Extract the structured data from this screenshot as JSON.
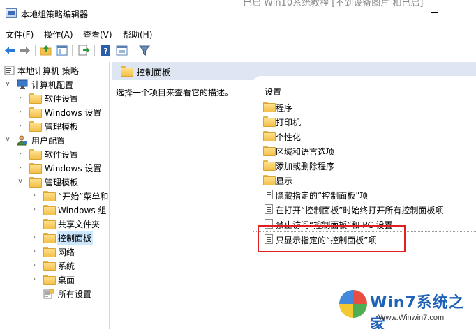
{
  "window": {
    "title": "本地组策略编辑器",
    "bg_title_fragment": "已启 Win10系统教程 [不到设备图片 相已启]"
  },
  "menu": [
    {
      "label": "文件(F)"
    },
    {
      "label": "操作(A)"
    },
    {
      "label": "查看(V)"
    },
    {
      "label": "帮助(H)"
    }
  ],
  "toolbar": [
    "back-icon",
    "forward-icon",
    "up-folder-icon",
    "show-hide-tree-icon",
    "export-list-icon",
    "help-icon",
    "properties-icon",
    "filter-icon"
  ],
  "tree": [
    {
      "label": "本地计算机 策略",
      "level": 0,
      "expander": "",
      "icon": "computer-policy-icon"
    },
    {
      "label": "计算机配置",
      "level": 1,
      "expander": "expanded",
      "icon": "computer-config-icon"
    },
    {
      "label": "软件设置",
      "level": 2,
      "expander": "collapsed",
      "icon": "folder-icon"
    },
    {
      "label": "Windows 设置",
      "level": 2,
      "expander": "collapsed",
      "icon": "folder-icon"
    },
    {
      "label": "管理模板",
      "level": 2,
      "expander": "collapsed",
      "icon": "folder-icon"
    },
    {
      "label": "用户配置",
      "level": 1,
      "expander": "expanded",
      "icon": "user-config-icon"
    },
    {
      "label": "软件设置",
      "level": 2,
      "expander": "collapsed",
      "icon": "folder-icon"
    },
    {
      "label": "Windows 设置",
      "level": 2,
      "expander": "collapsed",
      "icon": "folder-icon"
    },
    {
      "label": "管理模板",
      "level": 2,
      "expander": "expanded",
      "icon": "folder-icon"
    },
    {
      "label": "“开始”菜单和",
      "level": 3,
      "expander": "collapsed",
      "icon": "folder-icon"
    },
    {
      "label": "Windows 组",
      "level": 3,
      "expander": "collapsed",
      "icon": "folder-icon"
    },
    {
      "label": "共享文件夹",
      "level": 3,
      "expander": "",
      "icon": "folder-icon"
    },
    {
      "label": "控制面板",
      "level": 3,
      "expander": "collapsed",
      "icon": "folder-icon",
      "selected": true
    },
    {
      "label": "网络",
      "level": 3,
      "expander": "collapsed",
      "icon": "folder-icon"
    },
    {
      "label": "系统",
      "level": 3,
      "expander": "collapsed",
      "icon": "folder-icon"
    },
    {
      "label": "桌面",
      "level": 3,
      "expander": "collapsed",
      "icon": "folder-icon"
    },
    {
      "label": "所有设置",
      "level": 3,
      "expander": "",
      "icon": "all-settings-icon"
    }
  ],
  "content": {
    "header_title": "控制面板",
    "description": "选择一个项目来查看它的描述。",
    "column_header": "设置",
    "items": [
      {
        "label": "程序",
        "icon": "folder-icon"
      },
      {
        "label": "打印机",
        "icon": "folder-icon"
      },
      {
        "label": "个性化",
        "icon": "folder-icon"
      },
      {
        "label": "区域和语言选项",
        "icon": "folder-icon"
      },
      {
        "label": "添加或删除程序",
        "icon": "folder-icon"
      },
      {
        "label": "显示",
        "icon": "folder-icon"
      },
      {
        "label": "隐藏指定的“控制面板”项",
        "icon": "policy-setting-icon"
      },
      {
        "label": "在打开“控制面板”时始终打开所有控制面板项",
        "icon": "policy-setting-icon"
      },
      {
        "label": "禁止访问“控制面板”和 PC 设置",
        "icon": "policy-setting-icon"
      },
      {
        "label": "只显示指定的“控制面板”项",
        "icon": "policy-setting-icon",
        "highlighted": true
      }
    ]
  },
  "watermark": {
    "brand": "Win7系统之家",
    "url": "Www.Winwin7.com"
  },
  "colors": {
    "highlight_box": "#e02020",
    "selection": "#cce8ff",
    "header_bar": "#dde6f2"
  }
}
